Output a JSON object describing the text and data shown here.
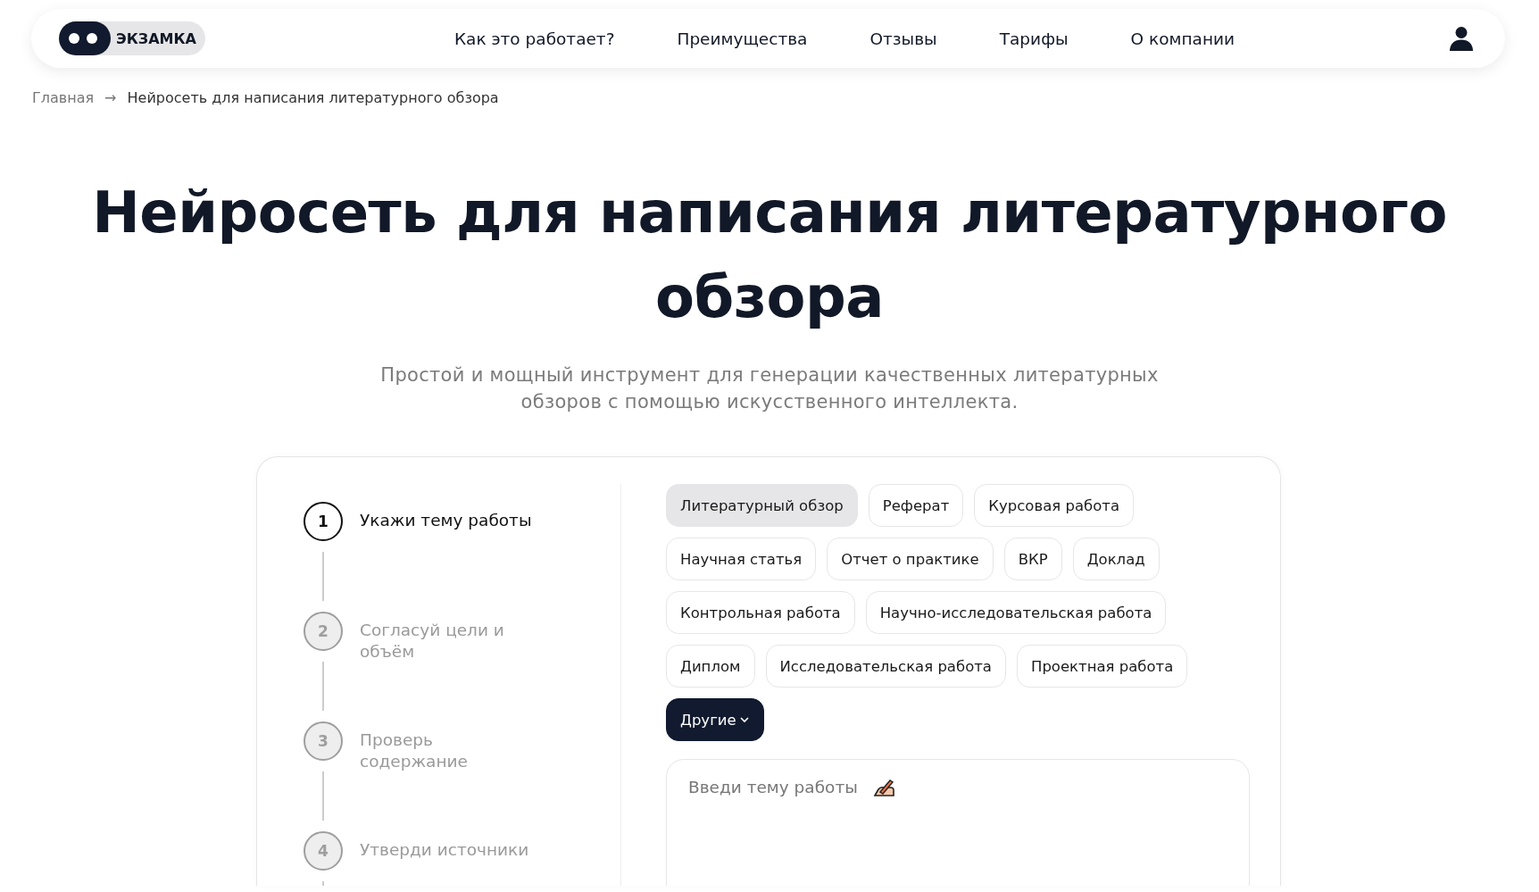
{
  "header": {
    "logo": {
      "text": "ЭКЗАМКА"
    },
    "nav": [
      {
        "label": "Как это работает?"
      },
      {
        "label": "Преимущества"
      },
      {
        "label": "Отзывы"
      },
      {
        "label": "Тарифы"
      },
      {
        "label": "О компании"
      }
    ]
  },
  "breadcrumbs": {
    "items": [
      {
        "label": "Главная"
      },
      {
        "label": "Нейросеть для написания литературного обзора"
      }
    ],
    "separator": "→"
  },
  "hero": {
    "title": "Нейросеть для написания литературного обзора",
    "subtitle": "Простой и мощный инструмент для генерации качественных литературных обзоров с помощью искусственного интеллекта."
  },
  "steps": [
    {
      "number": "1",
      "label": "Укажи тему работы",
      "selected": true
    },
    {
      "number": "2",
      "label": "Согласуй цели и объём",
      "selected": false
    },
    {
      "number": "3",
      "label": "Проверь содержание",
      "selected": false
    },
    {
      "number": "4",
      "label": "Утверди источники",
      "selected": false
    }
  ],
  "work_types": [
    {
      "kind": "chip",
      "label": "Литературный обзор",
      "selected": true
    },
    {
      "kind": "chip",
      "label": "Реферат",
      "selected": false
    },
    {
      "kind": "chip",
      "label": "Курсовая работа",
      "selected": false
    },
    {
      "kind": "chip",
      "label": "Научная статья",
      "selected": false
    },
    {
      "kind": "chip",
      "label": "Отчет о практике",
      "selected": false
    },
    {
      "kind": "chip",
      "label": "ВКР",
      "selected": false
    },
    {
      "kind": "chip",
      "label": "Доклад",
      "selected": false
    },
    {
      "kind": "chip",
      "label": "Контрольная работа",
      "selected": false
    },
    {
      "kind": "chip",
      "label": "Научно-исследовательская работа",
      "selected": false
    },
    {
      "kind": "chip",
      "label": "Диплом",
      "selected": false
    },
    {
      "kind": "chip",
      "label": "Исследовательская работа",
      "selected": false
    },
    {
      "kind": "chip",
      "label": "Проектная работа",
      "selected": false
    },
    {
      "kind": "dropdown",
      "label": "Другие"
    }
  ],
  "topic_field": {
    "placeholder": "Введи тему работы"
  }
}
